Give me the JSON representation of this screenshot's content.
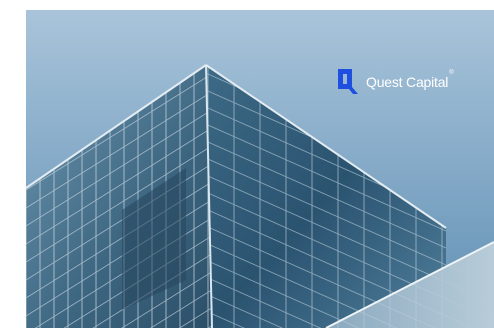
{
  "brand": {
    "name": "Quest Capital",
    "registered_mark": "®",
    "logo_color": "#1f4fe0"
  },
  "photo": {
    "subject": "building-icon"
  },
  "colors": {
    "sky_top": "#a9c4da",
    "sky_bottom": "#5f8fb4",
    "glass_dark": "#2f5570",
    "glass_light": "#6f98b4",
    "frame": "#d6e0e8"
  }
}
